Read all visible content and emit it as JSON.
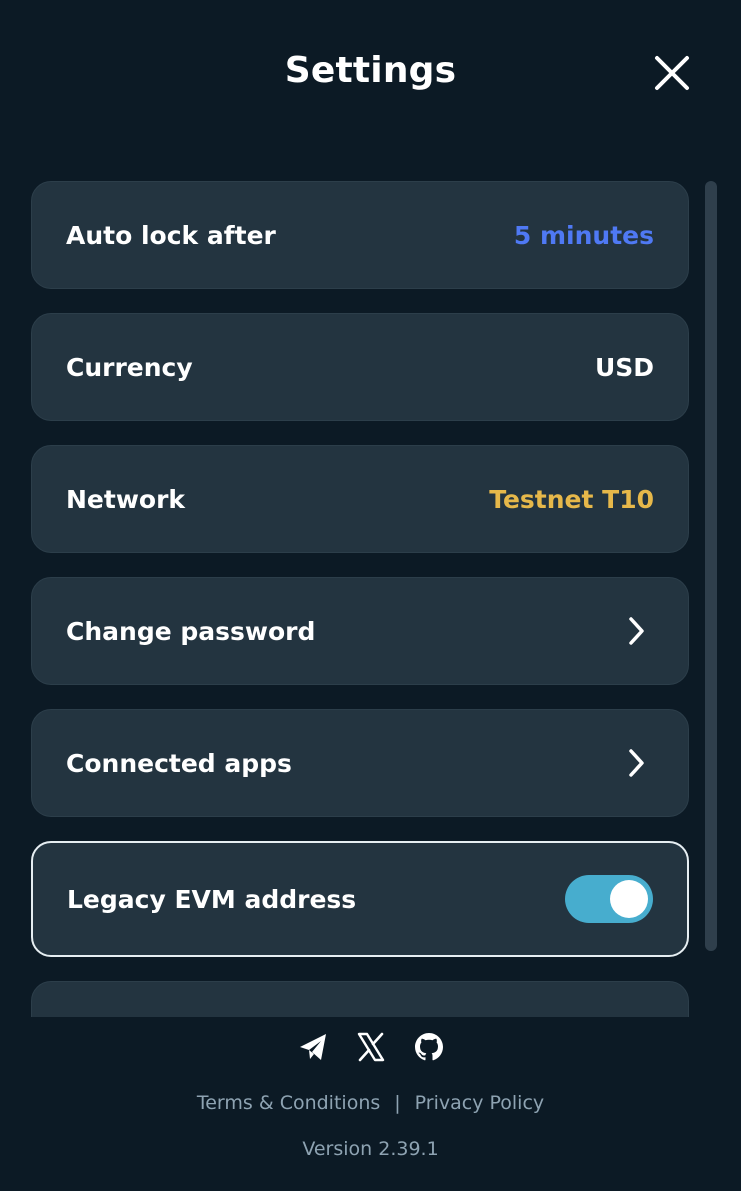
{
  "header": {
    "title": "Settings"
  },
  "settings": {
    "auto_lock": {
      "label": "Auto lock after",
      "value": "5 minutes",
      "value_color": "#4f79f4"
    },
    "currency": {
      "label": "Currency",
      "value": "USD",
      "value_color": "#ffffff"
    },
    "network": {
      "label": "Network",
      "value": "Testnet T10",
      "value_color": "#e6b84a"
    },
    "change_password": {
      "label": "Change password"
    },
    "connected_apps": {
      "label": "Connected apps"
    },
    "legacy_evm": {
      "label": "Legacy EVM address",
      "toggle_on": true
    }
  },
  "footer": {
    "social_icons": [
      "telegram-icon",
      "x-icon",
      "github-icon"
    ],
    "terms_label": "Terms & Conditions",
    "separator": "|",
    "privacy_label": "Privacy Policy",
    "version": "Version 2.39.1"
  },
  "colors": {
    "background": "#0c1a25",
    "row_background": "#233440",
    "toggle_on": "#47adce",
    "muted_text": "#8ea3b2"
  }
}
